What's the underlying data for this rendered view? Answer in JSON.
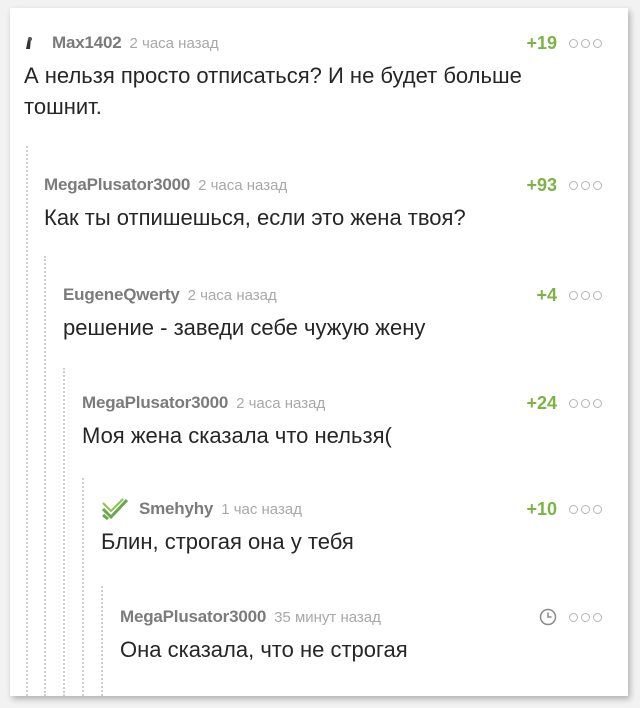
{
  "comments": [
    {
      "username": "Max1402",
      "time": "2 часа назад",
      "rating": "+19",
      "text": "А нельзя просто отписаться? И не будет больше тошнит.",
      "avatar_icon": "small-user-avatar-icon"
    },
    {
      "username": "MegaPlusator3000",
      "time": "2 часа назад",
      "rating": "+93",
      "text": "Как ты отпишешься, если это жена твоя?"
    },
    {
      "username": "EugeneQwerty",
      "time": "2 часа назад",
      "rating": "+4",
      "text": "решение - заведи себе чужую жену"
    },
    {
      "username": "MegaPlusator3000",
      "time": "2 часа назад",
      "rating": "+24",
      "text": "Моя жена сказала что нельзя("
    },
    {
      "username": "Smehyhy",
      "time": "1 час назад",
      "rating": "+10",
      "text": "Блин, строгая она у тебя",
      "avatar_icon": "green-checkmark-avatar-icon"
    },
    {
      "username": "MegaPlusator3000",
      "time": "35 минут назад",
      "rating_icon": "clock-icon",
      "text": "Она сказала, что не строгая"
    }
  ],
  "colors": {
    "rating": "#7cb342",
    "username": "#7b7b7b",
    "time": "#a8a8a8",
    "text": "#262626",
    "thread_line": "#cfcfcf"
  }
}
